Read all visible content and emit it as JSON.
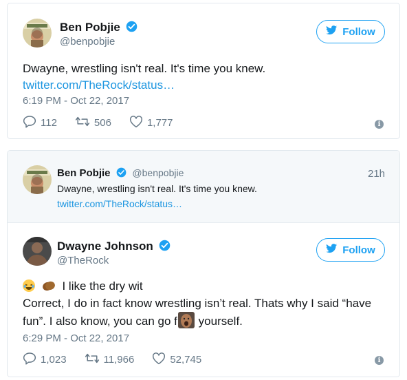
{
  "tweet1": {
    "name": "Ben Pobjie",
    "handle": "@benpobjie",
    "follow_label": "Follow",
    "text": "Dwayne, wrestling isn't real. It's time you knew.",
    "link": "twitter.com/TheRock/status…",
    "timestamp": "6:19 PM - Oct 22, 2017",
    "replies": "112",
    "retweets": "506",
    "likes": "1,777"
  },
  "tweet2": {
    "quoted": {
      "name": "Ben Pobjie",
      "handle": "@benpobjie",
      "age": "21h",
      "text": "Dwayne, wrestling isn't real. It's time you knew.",
      "link": "twitter.com/TheRock/status…"
    },
    "name": "Dwayne Johnson",
    "handle": "@TheRock",
    "follow_label": "Follow",
    "line1": "I like the dry wit",
    "line2": "Correct, I do in fact know wrestling isn’t real. Thats why I said “have",
    "line3a": "fun”. I also know, you can go f",
    "line3b": "yourself.",
    "timestamp": "6:29 PM - Oct 22, 2017",
    "replies": "1,023",
    "retweets": "11,966",
    "likes": "52,745"
  },
  "icons": {
    "verified": "verified-badge-icon",
    "bird": "twitter-bird-icon",
    "reply": "reply-icon",
    "retweet": "retweet-icon",
    "like": "heart-icon",
    "info": "info-icon"
  },
  "colors": {
    "accent": "#1da1f2",
    "link": "#1b95e0",
    "muted": "#657786",
    "border": "#e1e8ed"
  }
}
